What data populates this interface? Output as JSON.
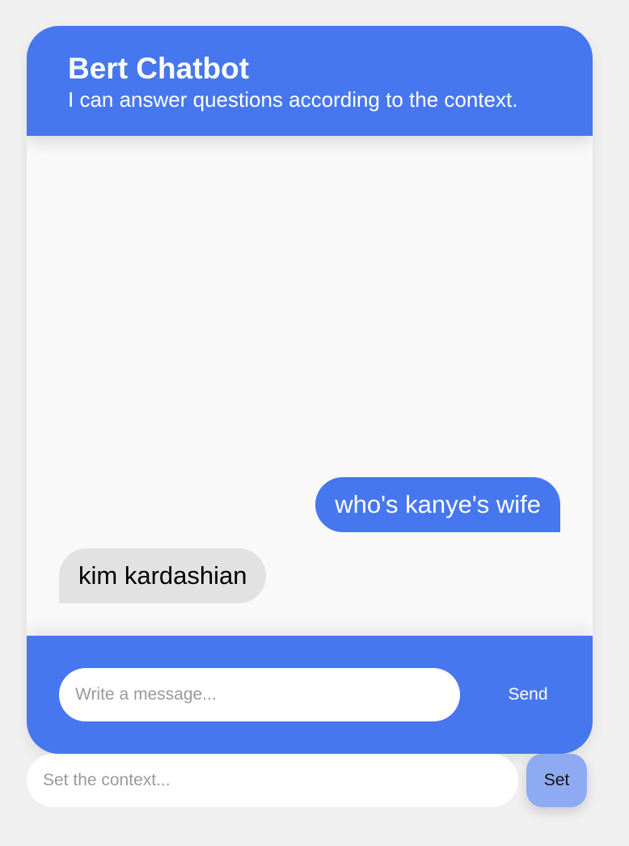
{
  "header": {
    "title": "Bert Chatbot",
    "subtitle": "I can answer questions according to the context."
  },
  "messages": [
    {
      "role": "user",
      "text": "who's kanye's wife"
    },
    {
      "role": "bot",
      "text": "kim kardashian"
    }
  ],
  "composer": {
    "placeholder": "Write a message...",
    "value": "",
    "send_label": "Send"
  },
  "context": {
    "placeholder": "Set the context...",
    "value": "",
    "set_label": "Set"
  },
  "colors": {
    "accent": "#4677ee",
    "user_bubble": "#4677ee",
    "bot_bubble": "#e2e2e2",
    "set_button": "#8eaaf2",
    "background": "#f0f0f0"
  }
}
